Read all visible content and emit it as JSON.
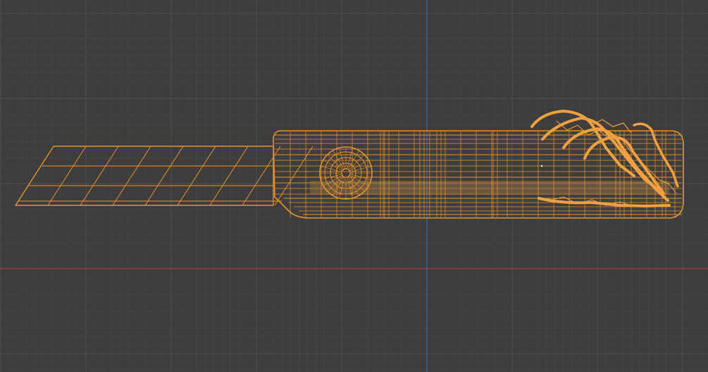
{
  "viewport": {
    "view": "orthographic-side-wireframe",
    "background_color": "#3d3d3d",
    "grid_minor_color": "#444444",
    "grid_major_color": "#4f4f4f",
    "x_axis_color": "#a23b45",
    "z_axis_color": "#3f68a6",
    "wireframe_color": "#e8922a",
    "wireframe_dense_color": "#f0a040",
    "objects": [
      {
        "name": "blade",
        "selected": true,
        "segments": 8
      },
      {
        "name": "handle",
        "selected": true
      },
      {
        "name": "slider-wheel",
        "selected": true
      },
      {
        "name": "skeleton-hand",
        "selected": true
      }
    ]
  }
}
